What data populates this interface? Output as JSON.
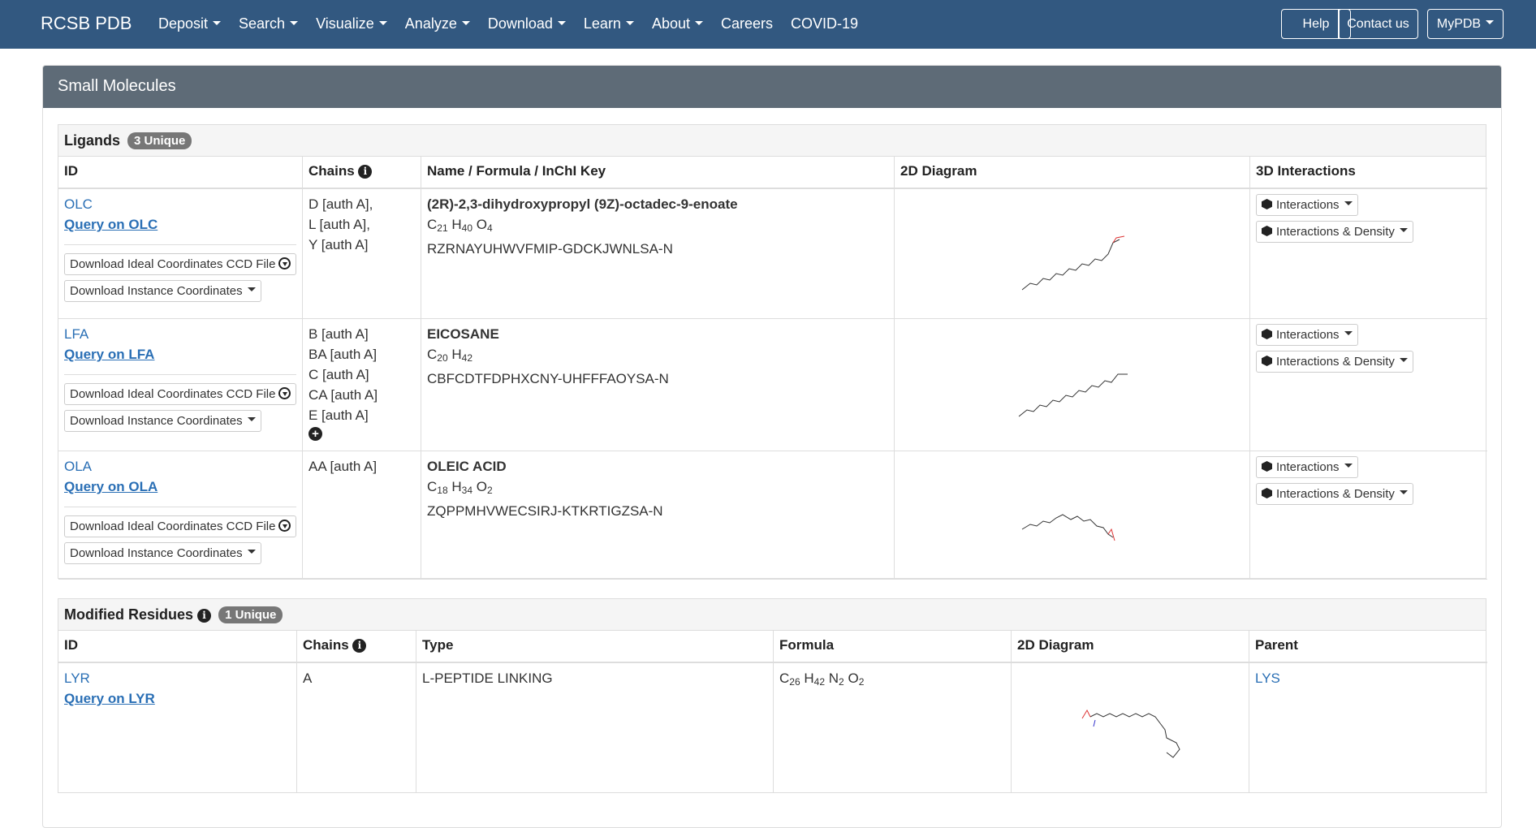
{
  "navbar": {
    "brand": "RCSB PDB",
    "items": [
      "Deposit",
      "Search",
      "Visualize",
      "Analyze",
      "Download",
      "Learn",
      "About",
      "Careers",
      "COVID-19"
    ],
    "help": "Help",
    "contact": "Contact us",
    "mypdb": "MyPDB"
  },
  "panel": {
    "title": "Small Molecules"
  },
  "ligands": {
    "title": "Ligands",
    "badge": "3 Unique",
    "headers": [
      "ID",
      "Chains",
      "Name / Formula / InChI Key",
      "2D Diagram",
      "3D Interactions"
    ],
    "download_ideal": "Download Ideal Coordinates CCD File",
    "download_instance": "Download Instance Coordinates",
    "interactions": "Interactions",
    "interactions_density": "Interactions & Density",
    "rows": [
      {
        "id": "OLC",
        "query": "Query on OLC",
        "chains": [
          "D [auth A],",
          "L [auth A],",
          "Y [auth A]"
        ],
        "name": "(2R)-2,3-dihydroxypropyl (9Z)-octadec-9-enoate",
        "formula": [
          [
            "C",
            "21"
          ],
          [
            "H",
            "40"
          ],
          [
            "O",
            "4"
          ]
        ],
        "inchi": "RZRNAYUHWVFMIP-GDCKJWNLSA-N"
      },
      {
        "id": "LFA",
        "query": "Query on LFA",
        "chains": [
          "B [auth A]",
          "BA [auth A]",
          "C [auth A]",
          "CA [auth A]",
          "E [auth A]"
        ],
        "name": "EICOSANE",
        "formula": [
          [
            "C",
            "20"
          ],
          [
            "H",
            "42"
          ]
        ],
        "inchi": "CBFCDTFDPHXCNY-UHFFFAOYSA-N"
      },
      {
        "id": "OLA",
        "query": "Query on OLA",
        "chains": [
          "AA [auth A]"
        ],
        "name": "OLEIC ACID",
        "formula": [
          [
            "C",
            "18"
          ],
          [
            "H",
            "34"
          ],
          [
            "O",
            "2"
          ]
        ],
        "inchi": "ZQPPMHVWECSIRJ-KTKRTIGZSA-N"
      }
    ]
  },
  "modified": {
    "title": "Modified Residues",
    "badge": "1 Unique",
    "headers": [
      "ID",
      "Chains",
      "Type",
      "Formula",
      "2D Diagram",
      "Parent"
    ],
    "row": {
      "id": "LYR",
      "query": "Query on LYR",
      "chain": "A",
      "type": "L-PEPTIDE LINKING",
      "formula": [
        [
          "C",
          "26"
        ],
        [
          "H",
          "42"
        ],
        [
          "N",
          "2"
        ],
        [
          "O",
          "2"
        ]
      ],
      "parent": "LYS"
    }
  },
  "icons": {
    "info": "info-circle-icon",
    "plus": "plus-circle-icon",
    "cube": "cube-icon",
    "download": "download-circle-icon"
  },
  "colors": {
    "navbar": "#325880",
    "panel_heading": "#5e6b77",
    "link": "#2a6fb5"
  }
}
